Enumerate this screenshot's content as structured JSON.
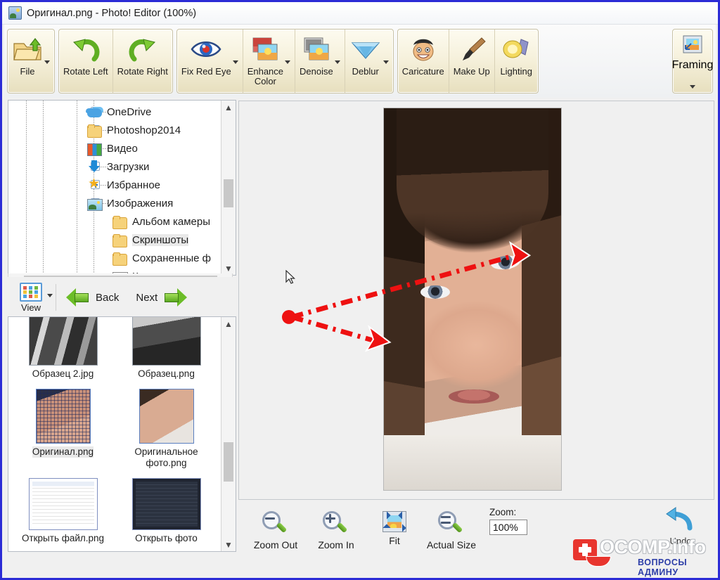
{
  "window": {
    "title": "Оригинал.png - Photo! Editor (100%)",
    "icon": "photo-editor-icon",
    "border_color": "#2b2bd6"
  },
  "ribbon": {
    "groups": [
      {
        "name": "file-group",
        "buttons": [
          {
            "label": "File",
            "icon": "open-folder-icon",
            "has_dropdown": true
          }
        ]
      },
      {
        "name": "rotate-group",
        "buttons": [
          {
            "label": "Rotate Left",
            "icon": "rotate-left-icon",
            "has_dropdown": false
          },
          {
            "label": "Rotate Right",
            "icon": "rotate-right-icon",
            "has_dropdown": false
          }
        ]
      },
      {
        "name": "correction-group",
        "buttons": [
          {
            "label": "Fix Red Eye",
            "icon": "red-eye-icon",
            "has_dropdown": true
          },
          {
            "label": "Enhance\nColor",
            "icon": "enhance-color-icon",
            "has_dropdown": true
          },
          {
            "label": "Denoise",
            "icon": "denoise-icon",
            "has_dropdown": true
          },
          {
            "label": "Deblur",
            "icon": "deblur-icon",
            "has_dropdown": true
          }
        ]
      },
      {
        "name": "effects-group",
        "buttons": [
          {
            "label": "Caricature",
            "icon": "caricature-icon",
            "has_dropdown": false
          },
          {
            "label": "Make Up",
            "icon": "makeup-brush-icon",
            "has_dropdown": false
          },
          {
            "label": "Lighting",
            "icon": "lighting-lamp-icon",
            "has_dropdown": false
          }
        ]
      }
    ],
    "framing": {
      "label": "Framing",
      "icon": "framing-icon",
      "has_dropdown": true
    }
  },
  "tree": {
    "items": [
      {
        "label": "OneDrive",
        "icon": "cloud-icon",
        "expander": "plus",
        "indent": 0
      },
      {
        "label": "Photoshop2014",
        "icon": "folder-icon",
        "expander": "plus",
        "indent": 0
      },
      {
        "label": "Видео",
        "icon": "video-folder-icon",
        "expander": "plus",
        "indent": 0
      },
      {
        "label": "Загрузки",
        "icon": "downloads-icon",
        "expander": "plus",
        "indent": 0
      },
      {
        "label": "Избранное",
        "icon": "favorites-star-icon",
        "expander": "plus",
        "indent": 0
      },
      {
        "label": "Изображения",
        "icon": "pictures-folder-icon",
        "expander": "minus",
        "indent": 0
      },
      {
        "label": "Альбом камеры",
        "icon": "folder-icon",
        "expander": "none",
        "indent": 1
      },
      {
        "label": "Скриншоты",
        "icon": "folder-icon",
        "expander": "none",
        "indent": 1,
        "selected": true
      },
      {
        "label": "Сохраненные ф",
        "icon": "folder-icon",
        "expander": "none",
        "indent": 1
      },
      {
        "label": "Контакты",
        "icon": "contacts-icon",
        "expander": "none",
        "indent": 1
      }
    ],
    "vscroll": {
      "up": "▲",
      "down": "▼"
    },
    "hscroll": {
      "left": "‹",
      "right": "›"
    }
  },
  "viewbar": {
    "view_label": "View",
    "back_label": "Back",
    "next_label": "Next"
  },
  "thumbnails": {
    "items": [
      {
        "name": "Образец 2.jpg",
        "kind": "wide",
        "thumb": "tm-bw1",
        "selected": false
      },
      {
        "name": "Образец.png",
        "kind": "wide",
        "thumb": "tm-bw2",
        "selected": false
      },
      {
        "name": "Оригинал.png",
        "kind": "square",
        "thumb": "tm-face-grid",
        "selected": true
      },
      {
        "name": "Оригинальное фото.png",
        "kind": "square",
        "thumb": "tm-face",
        "selected": false
      },
      {
        "name": "Открыть файл.png",
        "kind": "wide",
        "thumb": "tm-ui1",
        "selected": false
      },
      {
        "name": "Открыть фото",
        "kind": "wide",
        "thumb": "tm-ui2",
        "selected": false
      }
    ]
  },
  "canvas": {
    "photo_alt": "portrait-photo-girl",
    "cursor": "arrow-cursor",
    "annotation": {
      "color": "#ee1111",
      "style": "dash-dot",
      "origin_label": "red-dot-origin",
      "arrows": 2,
      "targets": [
        "left-eye",
        "right-eye"
      ]
    }
  },
  "bottombar": {
    "buttons": [
      {
        "label": "Zoom Out",
        "icon": "zoom-out-icon"
      },
      {
        "label": "Zoom In",
        "icon": "zoom-in-icon"
      },
      {
        "label": "Fit",
        "icon": "fit-icon"
      },
      {
        "label": "Actual Size",
        "icon": "actual-size-icon"
      }
    ],
    "zoom_field_label": "Zoom:",
    "zoom_value": "100%",
    "undo_label": "Undo",
    "undo_icon": "undo-arrow-icon"
  },
  "watermark": {
    "main": "OCOMP.info",
    "sub": "ВОПРОСЫ АДМИНУ",
    "icon": "first-aid-case-icon"
  }
}
